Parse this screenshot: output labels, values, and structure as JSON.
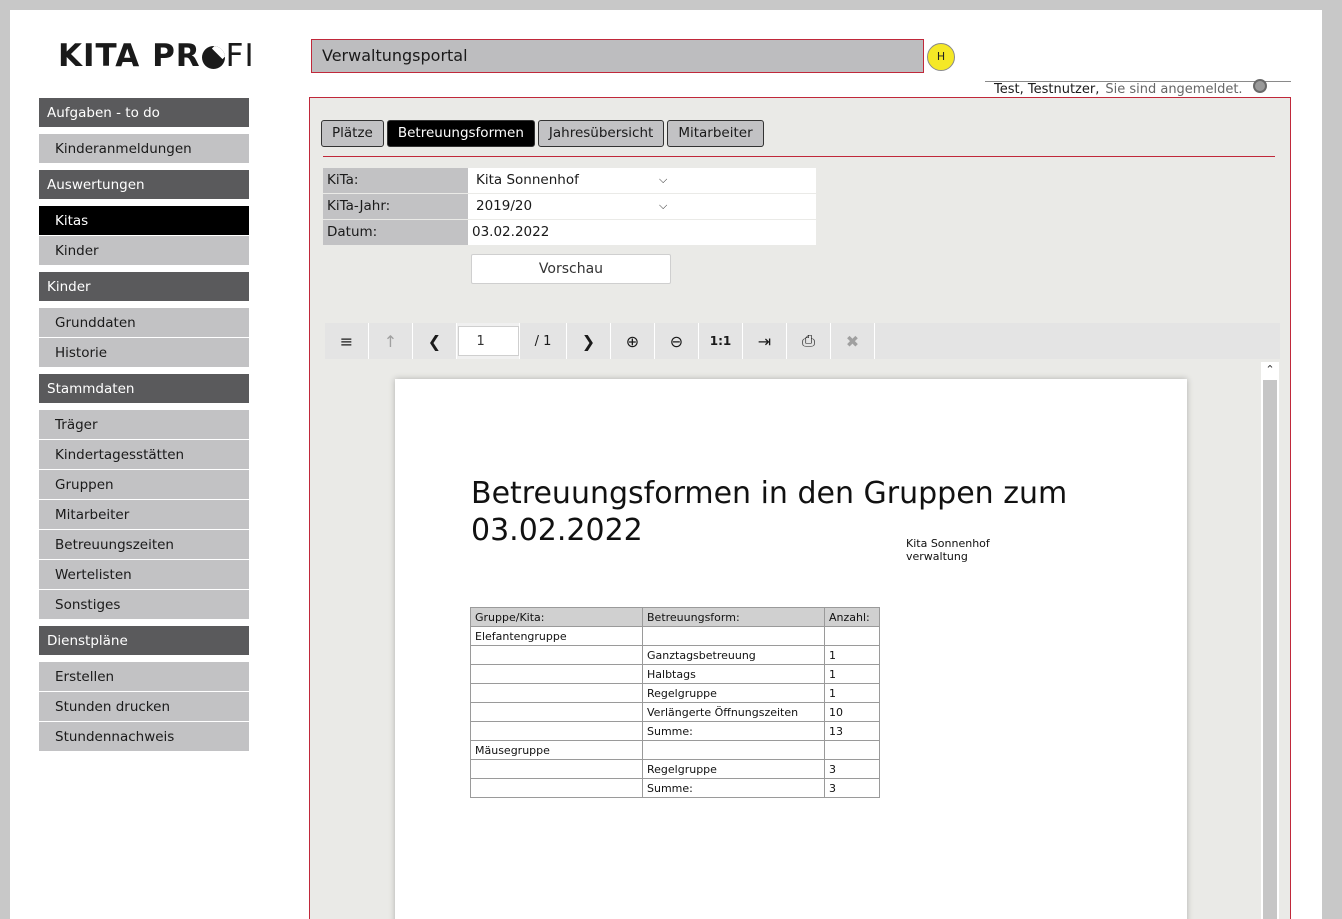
{
  "logo": {
    "part1": "KITA PR",
    "part2": "FI"
  },
  "sidebar": {
    "sections": [
      {
        "title": "Aufgaben - to do",
        "items": [
          {
            "label": "Kinderanmeldungen"
          }
        ]
      },
      {
        "title": "Auswertungen",
        "items": [
          {
            "label": "Kitas"
          },
          {
            "label": "Kinder"
          }
        ]
      },
      {
        "title": "Kinder",
        "items": [
          {
            "label": "Grunddaten"
          },
          {
            "label": "Historie"
          }
        ]
      },
      {
        "title": "Stammdaten",
        "items": [
          {
            "label": "Träger"
          },
          {
            "label": "Kindertagesstätten"
          },
          {
            "label": "Gruppen"
          },
          {
            "label": "Mitarbeiter"
          },
          {
            "label": "Betreuungszeiten"
          },
          {
            "label": "Wertelisten"
          },
          {
            "label": "Sonstiges"
          }
        ]
      },
      {
        "title": "Dienstpläne",
        "items": [
          {
            "label": "Erstellen"
          },
          {
            "label": "Stunden drucken"
          },
          {
            "label": "Stundennachweis"
          }
        ]
      }
    ]
  },
  "header": {
    "portal_title": "Verwaltungsportal",
    "help_label": "H",
    "user_name": "Test, Testnutzer,",
    "user_status": "Sie sind angemeldet."
  },
  "tabs": [
    {
      "label": "Plätze"
    },
    {
      "label": "Betreuungsformen"
    },
    {
      "label": "Jahresübersicht"
    },
    {
      "label": "Mitarbeiter"
    }
  ],
  "form": {
    "kita_label": "KiTa:",
    "kita_value": "Kita Sonnenhof",
    "year_label": "KiTa-Jahr:",
    "year_value": "2019/20",
    "date_label": "Datum:",
    "date_value": "03.02.2022",
    "preview_button": "Vorschau"
  },
  "toolbar": {
    "page_value": "1",
    "page_total": "/ 1",
    "ratio_label": "1:1"
  },
  "report": {
    "title": "Betreuungsformen in den Gruppen zum 03.02.2022",
    "kita_name": "Kita Sonnenhof",
    "sub_name": "verwaltung",
    "columns": [
      "Gruppe/Kita:",
      "Betreuungsform:",
      "Anzahl:"
    ],
    "rows": [
      [
        "Elefantengruppe",
        "",
        ""
      ],
      [
        "",
        "Ganztagsbetreuung",
        "1"
      ],
      [
        "",
        "Halbtags",
        "1"
      ],
      [
        "",
        "Regelgruppe",
        "1"
      ],
      [
        "",
        "Verlängerte Öffnungszeiten",
        "10"
      ],
      [
        "",
        "Summe:",
        "13"
      ],
      [
        "Mäusegruppe",
        "",
        ""
      ],
      [
        "",
        "Regelgruppe",
        "3"
      ],
      [
        "",
        "Summe:",
        "3"
      ]
    ]
  }
}
